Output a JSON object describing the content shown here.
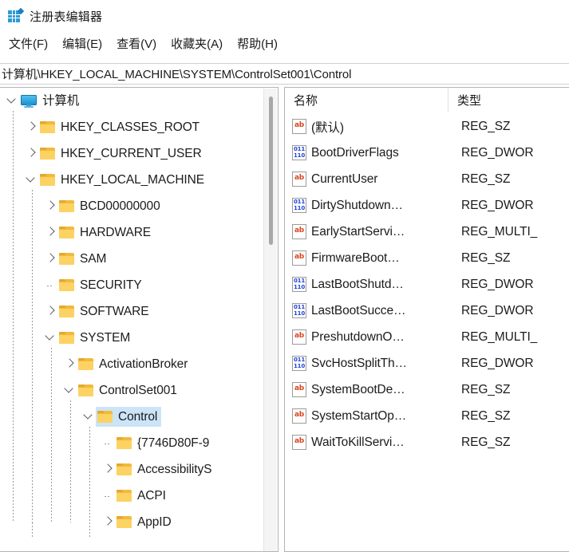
{
  "window": {
    "title": "注册表编辑器",
    "icon": "registry-editor-icon"
  },
  "menubar": {
    "items": [
      {
        "label": "文件(F)"
      },
      {
        "label": "编辑(E)"
      },
      {
        "label": "查看(V)"
      },
      {
        "label": "收藏夹(A)"
      },
      {
        "label": "帮助(H)"
      }
    ]
  },
  "address": {
    "path": "计算机\\HKEY_LOCAL_MACHINE\\SYSTEM\\ControlSet001\\Control"
  },
  "tree": {
    "items": [
      {
        "label": "计算机",
        "icon": "computer-monitor-icon",
        "indent": 0,
        "twisty": "down",
        "selected": false
      },
      {
        "label": "HKEY_CLASSES_ROOT",
        "icon": "folder-icon",
        "indent": 1,
        "twisty": "right",
        "selected": false
      },
      {
        "label": "HKEY_CURRENT_USER",
        "icon": "folder-icon",
        "indent": 1,
        "twisty": "right",
        "selected": false
      },
      {
        "label": "HKEY_LOCAL_MACHINE",
        "icon": "folder-icon",
        "indent": 1,
        "twisty": "down",
        "selected": false
      },
      {
        "label": "BCD00000000",
        "icon": "folder-icon",
        "indent": 2,
        "twisty": "right",
        "selected": false
      },
      {
        "label": "HARDWARE",
        "icon": "folder-icon",
        "indent": 2,
        "twisty": "right",
        "selected": false
      },
      {
        "label": "SAM",
        "icon": "folder-icon",
        "indent": 2,
        "twisty": "right",
        "selected": false
      },
      {
        "label": "SECURITY",
        "icon": "folder-icon",
        "indent": 2,
        "twisty": "none",
        "selected": false
      },
      {
        "label": "SOFTWARE",
        "icon": "folder-icon",
        "indent": 2,
        "twisty": "right",
        "selected": false
      },
      {
        "label": "SYSTEM",
        "icon": "folder-icon",
        "indent": 2,
        "twisty": "down",
        "selected": false
      },
      {
        "label": "ActivationBroker",
        "icon": "folder-icon",
        "indent": 3,
        "twisty": "right",
        "selected": false
      },
      {
        "label": "ControlSet001",
        "icon": "folder-icon",
        "indent": 3,
        "twisty": "down",
        "selected": false
      },
      {
        "label": "Control",
        "icon": "folder-icon",
        "indent": 4,
        "twisty": "down",
        "selected": true
      },
      {
        "label": "{7746D80F-9",
        "icon": "folder-icon",
        "indent": 5,
        "twisty": "none",
        "selected": false
      },
      {
        "label": "AccessibilityS",
        "icon": "folder-icon",
        "indent": 5,
        "twisty": "right",
        "selected": false
      },
      {
        "label": "ACPI",
        "icon": "folder-icon",
        "indent": 5,
        "twisty": "none",
        "selected": false
      },
      {
        "label": "AppID",
        "icon": "folder-icon",
        "indent": 5,
        "twisty": "right",
        "selected": false
      }
    ]
  },
  "list": {
    "columns": [
      {
        "label": "名称"
      },
      {
        "label": "类型"
      }
    ],
    "rows": [
      {
        "name": "(默认)",
        "type": "REG_SZ",
        "icon": "string-value-icon"
      },
      {
        "name": "BootDriverFlags",
        "type": "REG_DWOR",
        "icon": "dword-value-icon"
      },
      {
        "name": "CurrentUser",
        "type": "REG_SZ",
        "icon": "string-value-icon"
      },
      {
        "name": "DirtyShutdown…",
        "type": "REG_DWOR",
        "icon": "dword-value-icon"
      },
      {
        "name": "EarlyStartServi…",
        "type": "REG_MULTI_",
        "icon": "string-value-icon"
      },
      {
        "name": "FirmwareBoot…",
        "type": "REG_SZ",
        "icon": "string-value-icon"
      },
      {
        "name": "LastBootShutd…",
        "type": "REG_DWOR",
        "icon": "dword-value-icon"
      },
      {
        "name": "LastBootSucce…",
        "type": "REG_DWOR",
        "icon": "dword-value-icon"
      },
      {
        "name": "PreshutdownO…",
        "type": "REG_MULTI_",
        "icon": "string-value-icon"
      },
      {
        "name": "SvcHostSplitTh…",
        "type": "REG_DWOR",
        "icon": "dword-value-icon"
      },
      {
        "name": "SystemBootDe…",
        "type": "REG_SZ",
        "icon": "string-value-icon"
      },
      {
        "name": "SystemStartOp…",
        "type": "REG_SZ",
        "icon": "string-value-icon"
      },
      {
        "name": "WaitToKillServi…",
        "type": "REG_SZ",
        "icon": "string-value-icon"
      }
    ]
  },
  "icon_labels": {
    "string": "ab",
    "dword_top": "011",
    "dword_bottom": "110"
  },
  "colors": {
    "selection": "#cce4f7",
    "folder": "#fcd263",
    "string_icon": "#d8451f",
    "dword_icon": "#1f43d8",
    "app_icon": "#2e9bd6"
  }
}
